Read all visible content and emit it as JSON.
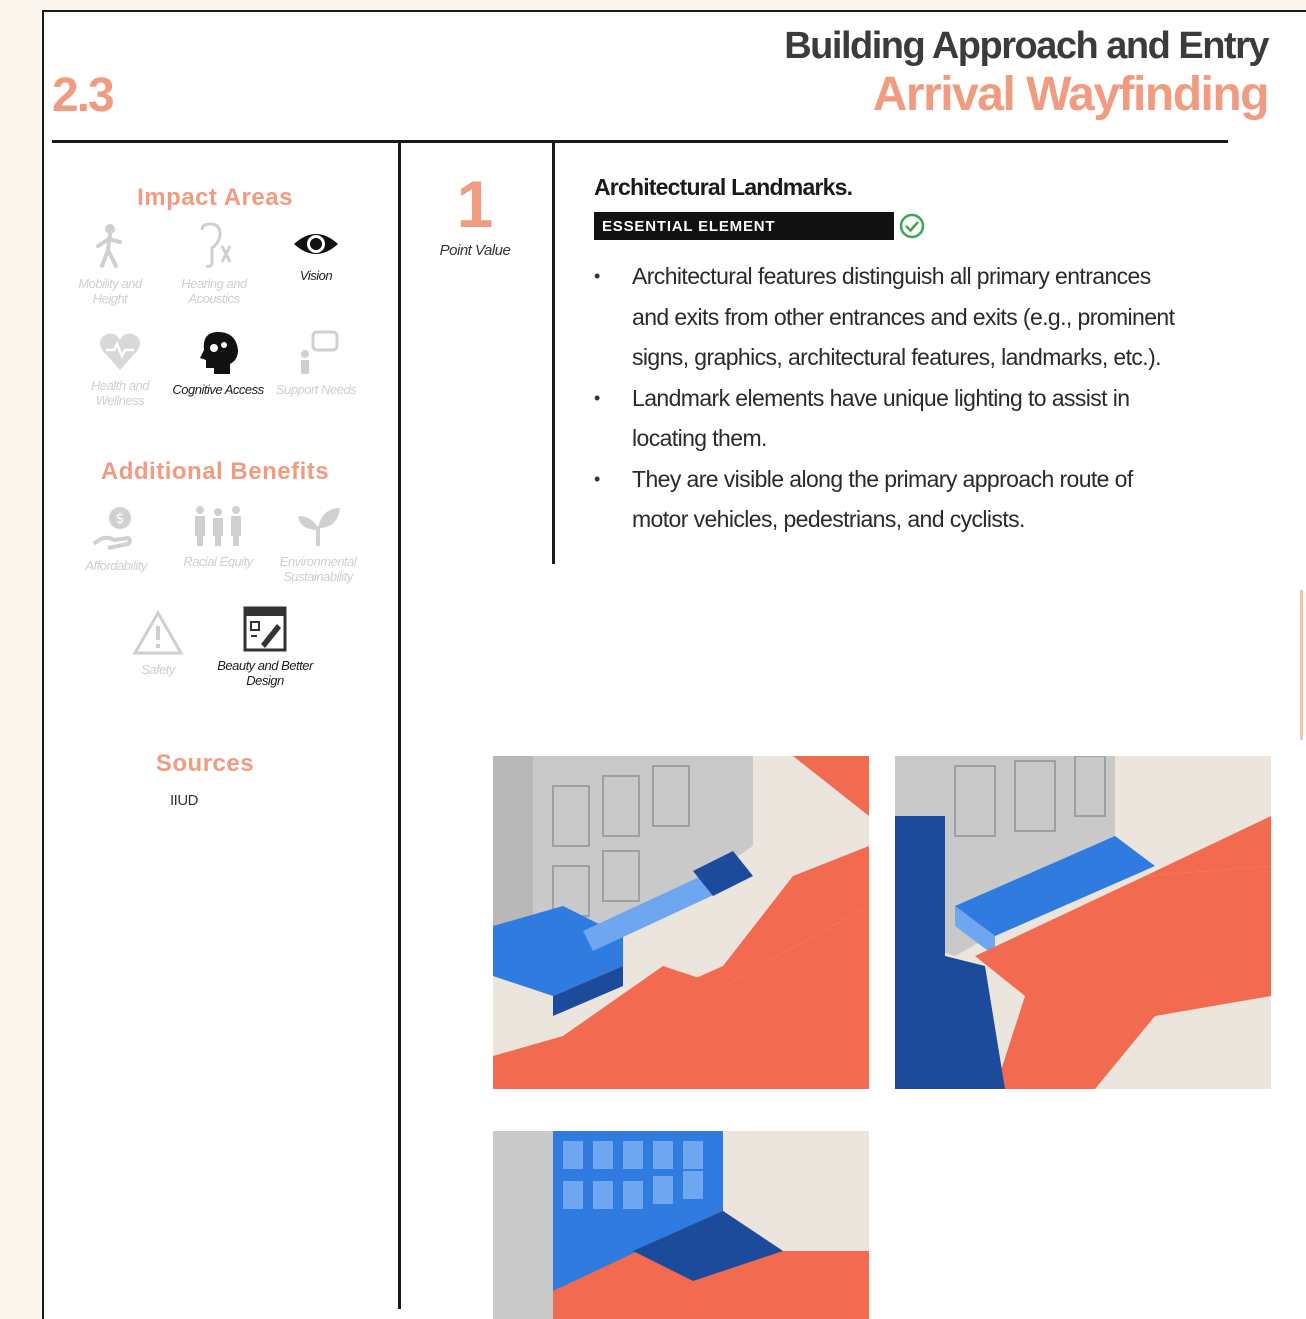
{
  "header": {
    "section_number": "2.3",
    "title_line1": "Building Approach and Entry",
    "title_line2": "Arrival Wayfinding"
  },
  "sidebar": {
    "impact_heading": "Impact Areas",
    "impact_items": [
      {
        "label": "Mobility and Height",
        "icon": "mobility-icon",
        "active": false
      },
      {
        "label": "Hearing and Acoustics",
        "icon": "hearing-icon",
        "active": false
      },
      {
        "label": "Vision",
        "icon": "eye-icon",
        "active": true
      },
      {
        "label": "Health and Wellness",
        "icon": "heart-icon",
        "active": false
      },
      {
        "label": "Cognitive Access",
        "icon": "brain-icon",
        "active": true
      },
      {
        "label": "Support Needs",
        "icon": "support-icon",
        "active": false
      }
    ],
    "benefits_heading": "Additional Benefits",
    "benefit_items": [
      {
        "label": "Affordability",
        "icon": "money-hand-icon",
        "active": false
      },
      {
        "label": "Racial Equity",
        "icon": "people-icon",
        "active": false
      },
      {
        "label": "Environmental Sustainability",
        "icon": "leaf-icon",
        "active": false
      },
      {
        "label": "Safety",
        "icon": "warning-icon",
        "active": false
      },
      {
        "label": "Beauty and Better Design",
        "icon": "design-icon",
        "active": true
      }
    ],
    "sources_heading": "Sources",
    "sources_text": "IIUD"
  },
  "point": {
    "value": "1",
    "label": "Point Value"
  },
  "content": {
    "title": "Architectural Landmarks.",
    "badge": "ESSENTIAL ELEMENT",
    "bullets": [
      "Architectural features distinguish all primary entrances and exits from other entrances and exits (e.g., prominent signs, graphics, architectural features, landmarks, etc.).",
      "Landmark elements have unique lighting to assist in locating them.",
      "They are visible along the primary approach route of motor vehicles, pedestrians, and cyclists."
    ]
  },
  "colors": {
    "accent_salmon": "#f19b80",
    "ink": "#1a1a1a",
    "illus_red": "#f26b50",
    "illus_blue": "#2f7be0",
    "illus_navy": "#1c4b9c",
    "illus_grey": "#c9c9c9",
    "illus_beige": "#ece5dd"
  }
}
